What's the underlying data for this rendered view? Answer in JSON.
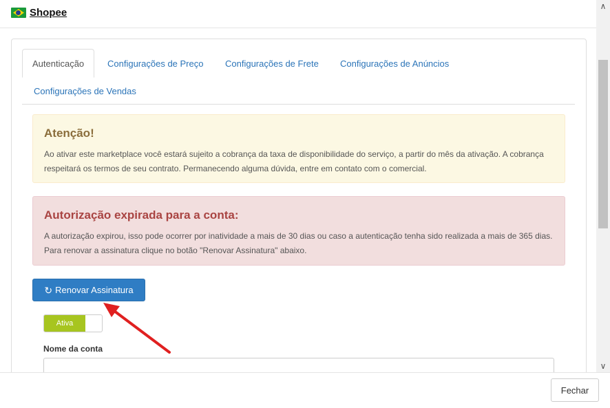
{
  "header": {
    "title": "Shopee",
    "flag_icon": "brazil-flag-icon"
  },
  "tabs": [
    {
      "label": "Autenticação",
      "active": true
    },
    {
      "label": "Configurações de Preço"
    },
    {
      "label": "Configurações de Frete"
    },
    {
      "label": "Configurações de Anúncios"
    },
    {
      "label": "Configurações de Vendas"
    }
  ],
  "warning": {
    "title": "Atenção!",
    "text": "Ao ativar este marketplace você estará sujeito a cobrança da taxa de disponibilidade do serviço, a partir do mês da ativação. A cobrança respeitará os termos de seu contrato. Permanecendo alguma dúvida, entre em contato com o comercial."
  },
  "danger": {
    "title": "Autorização expirada para a conta:",
    "text": "A autorização expirou, isso pode ocorrer por inatividade a mais de 30 dias ou caso a autenticação tenha sido realizada a mais de 365 dias. Para renovar a assinatura clique no botão \"Renovar Assinatura\" abaixo."
  },
  "renew_button": {
    "label": "Renovar Assinatura",
    "icon": "refresh-icon"
  },
  "toggle": {
    "label": "Ativa",
    "state": "on"
  },
  "account": {
    "label": "Nome da conta",
    "value": ""
  },
  "footer": {
    "close_label": "Fechar"
  },
  "colors": {
    "primary": "#2f7dc4",
    "toggle_on": "#a7c520",
    "warning_bg": "#fcf8e3",
    "danger_bg": "#f2dede",
    "arrow": "#e02020"
  }
}
